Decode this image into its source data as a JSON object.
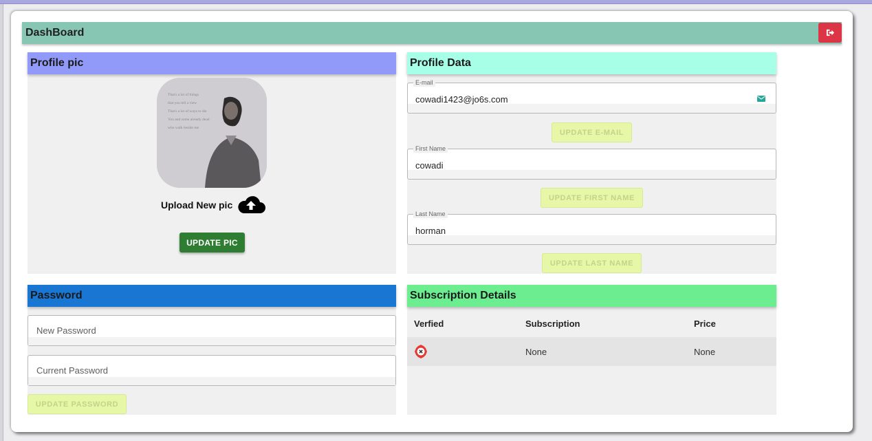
{
  "dashboard": {
    "title": "DashBoard",
    "logout_icon": "logout-icon",
    "logout_color": "#dc3545"
  },
  "profile_pic": {
    "heading": "Profile pic",
    "avatar_lines": [
      "That's a lot of things",
      "that you tell a view",
      "That's a lot of ways to die",
      "You and some already dead",
      "who walk beside me"
    ],
    "upload_label": "Upload New pic",
    "upload_icon": "cloud-upload-icon",
    "update_button": "UPDATE PIC"
  },
  "profile_data": {
    "heading": "Profile Data",
    "email": {
      "label": "E-mail",
      "value": "cowadi1423@jo6s.com",
      "icon": "email-icon",
      "button": "UPDATE E-MAIL"
    },
    "first_name": {
      "label": "First Name",
      "value": "cowadi",
      "button": "UPDATE FIRST NAME"
    },
    "last_name": {
      "label": "Last Name",
      "value": "horman",
      "button": "UPDATE LAST NAME"
    }
  },
  "password": {
    "heading": "Password",
    "new_placeholder": "New Password",
    "current_placeholder": "Current Password",
    "button": "UPDATE PASSWORD"
  },
  "subscription": {
    "heading": "Subscription Details",
    "columns": [
      "Verfied",
      "Subscription",
      "Price"
    ],
    "row": {
      "verified_icon": "not-verified-icon",
      "subscription": "None",
      "price": "None"
    }
  },
  "colors": {
    "dash_bar": "#88c6b4",
    "profile_pic_head": "#9199f9",
    "profile_data_head": "#a7ffe7",
    "password_head": "#1976d2",
    "subscription_head": "#6ced90",
    "update_pic_button": "#2e7d32",
    "disabled_button": "#e6f7a7"
  }
}
